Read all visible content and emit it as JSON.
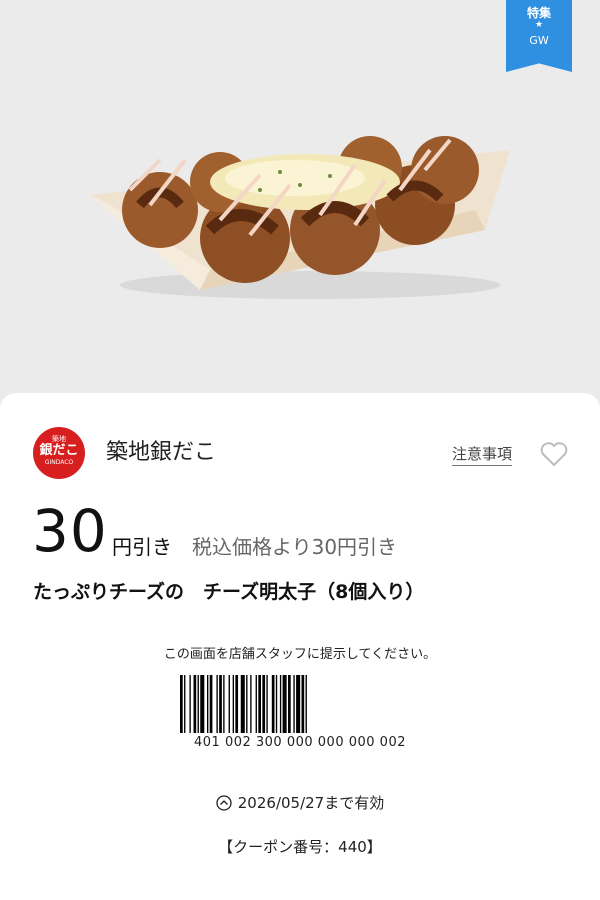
{
  "ribbon": {
    "line1": "特集",
    "star": "★",
    "line2": "GW"
  },
  "brand": {
    "name": "築地銀だこ",
    "logo_top": "築地",
    "logo_main": "銀だこ",
    "logo_sub": "GINDACO"
  },
  "header": {
    "notes_link": "注意事項",
    "favorite_icon": "heart-outline-icon"
  },
  "offer": {
    "amount": "30",
    "unit": "円引き",
    "detail": "税込価格より30円引き",
    "product": "たっぷりチーズの　チーズ明太子（8個入り）"
  },
  "redeem": {
    "instruction": "この画面を店舗スタッフに提示してください。",
    "barcode_number": "401 002 300 000 000 000 002"
  },
  "expiry": {
    "icon": "clock-icon",
    "text": "2026/05/27まで有効"
  },
  "coupon": {
    "number_label": "【クーポン番号：440】"
  },
  "colors": {
    "ribbon": "#2f8fe0",
    "logo": "#d71f1f",
    "background": "#ebebeb"
  }
}
